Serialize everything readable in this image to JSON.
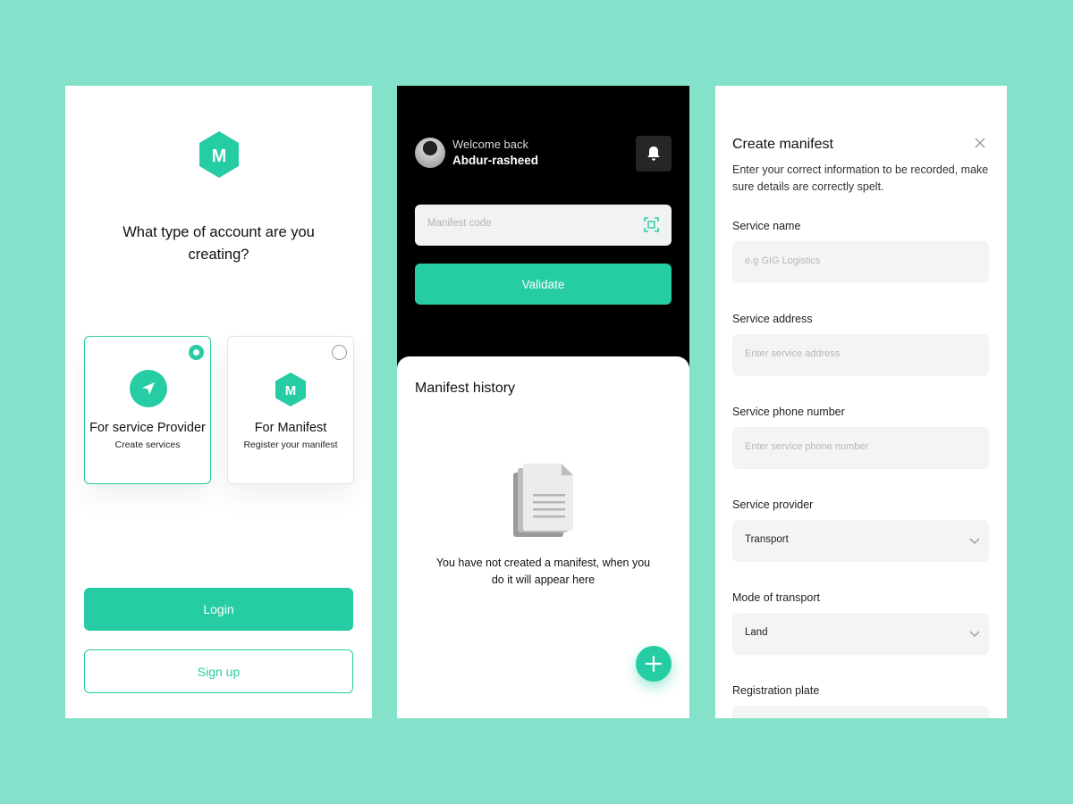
{
  "colors": {
    "background": "#84e1ca",
    "accent": "#26cca3",
    "dark": "#000000"
  },
  "screen1": {
    "logo_letter": "M",
    "question": "What type of account are you creating?",
    "cards": [
      {
        "title": "For service Provider",
        "subtitle": "Create services",
        "selected": true,
        "icon": "navigation-arrow-icon"
      },
      {
        "title": "For Manifest",
        "subtitle": "Register your manifest",
        "selected": false,
        "icon": "m-hexagon-icon"
      }
    ],
    "login_label": "Login",
    "signup_label": "Sign up"
  },
  "screen2": {
    "welcome": "Welcome back",
    "username": "Abdur-rasheed",
    "manifest_code_placeholder": "Manifest code",
    "validate_label": "Validate",
    "history_title": "Manifest history",
    "empty_message": "You have not created a manifest, when you do it will appear here",
    "icons": [
      "bell-icon",
      "scan-icon",
      "document-icon",
      "plus-icon"
    ]
  },
  "screen3": {
    "title": "Create manifest",
    "description": "Enter your correct information to be recorded, make sure details are correctly spelt.",
    "fields": [
      {
        "label": "Service name",
        "placeholder": "e.g GIG Logistics",
        "value": ""
      },
      {
        "label": "Service address",
        "placeholder": "Enter service address",
        "value": ""
      },
      {
        "label": "Service phone number",
        "placeholder": "Enter service phone number",
        "value": ""
      },
      {
        "label": "Service provider",
        "placeholder": "",
        "value": "Transport",
        "type": "select"
      },
      {
        "label": "Mode of transport",
        "placeholder": "",
        "value": "Land",
        "type": "select"
      },
      {
        "label": "Registration plate",
        "placeholder": "",
        "value": ""
      }
    ]
  }
}
